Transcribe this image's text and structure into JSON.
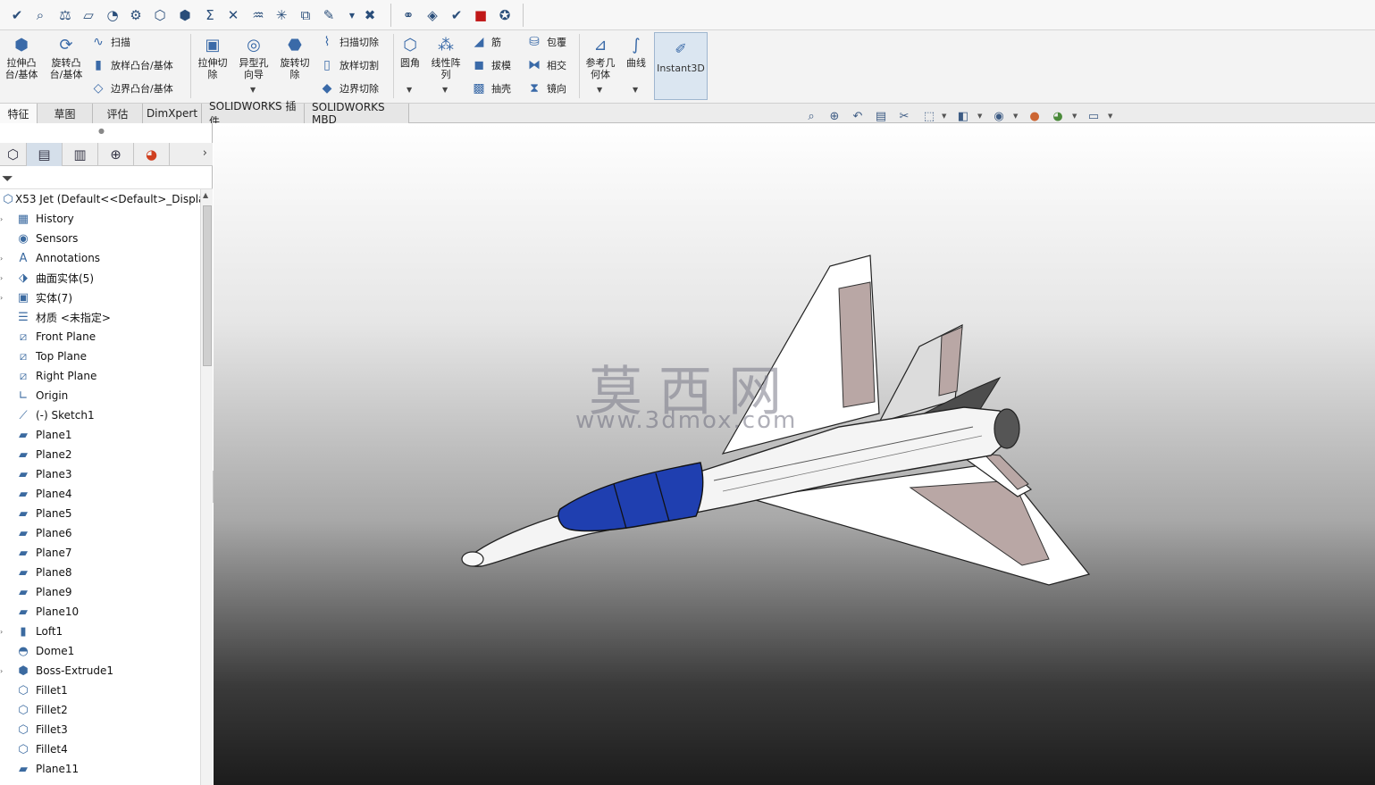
{
  "quick_access": {
    "icons": [
      "spellcheck-icon",
      "zoom-icon",
      "balance-icon",
      "sketch-icon",
      "performance-icon",
      "mass-icon",
      "section-icon",
      "check-icon",
      "sum-icon",
      "measure-icon",
      "pressure-icon",
      "symmetry-icon",
      "compare-icon",
      "deviation-icon",
      "import-icon",
      "orientation-icon",
      "curvature-icon",
      "verify-icon",
      "appearance-icon",
      "settings-icon"
    ]
  },
  "ribbon": {
    "extrude_boss": "拉伸凸\n台/基体",
    "revolve_boss": "旋转凸\n台/基体",
    "sweep": "扫描",
    "loft_boss": "放样凸台/基体",
    "boundary_boss": "边界凸台/基体",
    "extrude_cut": "拉伸切\n除",
    "hole_wizard": "异型孔\n向导",
    "revolve_cut": "旋转切\n除",
    "swept_cut": "扫描切除",
    "lofted_cut": "放样切割",
    "boundary_cut": "边界切除",
    "fillet": "圆角",
    "linear_pattern": "线性阵\n列",
    "rib": "筋",
    "draft": "拔模",
    "shell": "抽壳",
    "wrap": "包覆",
    "intersect": "相交",
    "mirror": "镜向",
    "ref_geometry": "参考几\n何体",
    "curves": "曲线",
    "instant3d": "Instant3D"
  },
  "tabs": [
    "特征",
    "草图",
    "评估",
    "DimXpert",
    "SOLIDWORKS 插件",
    "SOLIDWORKS MBD"
  ],
  "active_tab": "特征",
  "heads_up": [
    "zoom-to-fit-icon",
    "zoom-area-icon",
    "previous-view-icon",
    "section-view-icon",
    "dynamic-annotation-icon",
    "view-orientation-icon",
    "display-style-icon",
    "hide-show-icon",
    "edit-appearance-icon",
    "apply-scene-icon",
    "view-settings-icon"
  ],
  "feature_tree": {
    "root": "X53 Jet  (Default<<Default>_Displa",
    "items": [
      {
        "label": "History",
        "icon": "history-icon"
      },
      {
        "label": "Sensors",
        "icon": "sensor-icon"
      },
      {
        "label": "Annotations",
        "icon": "annotations-icon"
      },
      {
        "label": "曲面实体(5)",
        "icon": "surface-bodies-icon"
      },
      {
        "label": "实体(7)",
        "icon": "solid-bodies-icon"
      },
      {
        "label": "材质 <未指定>",
        "icon": "material-icon"
      },
      {
        "label": "Front Plane",
        "icon": "plane-icon"
      },
      {
        "label": "Top Plane",
        "icon": "plane-icon"
      },
      {
        "label": "Right Plane",
        "icon": "plane-icon"
      },
      {
        "label": "Origin",
        "icon": "origin-icon"
      },
      {
        "label": "(-) Sketch1",
        "icon": "sketch-icon"
      },
      {
        "label": "Plane1",
        "icon": "plane-icon"
      },
      {
        "label": "Plane2",
        "icon": "plane-icon"
      },
      {
        "label": "Plane3",
        "icon": "plane-icon"
      },
      {
        "label": "Plane4",
        "icon": "plane-icon"
      },
      {
        "label": "Plane5",
        "icon": "plane-icon"
      },
      {
        "label": "Plane6",
        "icon": "plane-icon"
      },
      {
        "label": "Plane7",
        "icon": "plane-icon"
      },
      {
        "label": "Plane8",
        "icon": "plane-icon"
      },
      {
        "label": "Plane9",
        "icon": "plane-icon"
      },
      {
        "label": "Plane10",
        "icon": "plane-icon"
      },
      {
        "label": "Loft1",
        "icon": "loft-icon"
      },
      {
        "label": "Dome1",
        "icon": "dome-icon"
      },
      {
        "label": "Boss-Extrude1",
        "icon": "extrude-icon"
      },
      {
        "label": "Fillet1",
        "icon": "fillet-icon"
      },
      {
        "label": "Fillet2",
        "icon": "fillet-icon"
      },
      {
        "label": "Fillet3",
        "icon": "fillet-icon"
      },
      {
        "label": "Fillet4",
        "icon": "fillet-icon"
      },
      {
        "label": "Plane11",
        "icon": "plane-icon"
      }
    ]
  },
  "watermark": {
    "cn": "莫西网",
    "url": "www.3dmox.com"
  },
  "colors": {
    "canopy": "#1f3fb0",
    "fuselage": "#f4f4f4",
    "flaps": "#b9a7a5"
  }
}
